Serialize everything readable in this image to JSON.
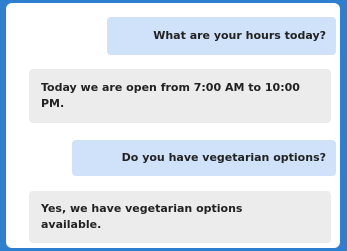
{
  "conversation": {
    "messages": [
      {
        "sender": "user",
        "text": "What are your hours today?"
      },
      {
        "sender": "bot",
        "text": "Today we are open from 7:00 AM to 10:00 PM."
      },
      {
        "sender": "user",
        "text": "Do you have vegetarian options?"
      },
      {
        "sender": "bot",
        "text": "Yes, we have vegetarian options available."
      }
    ]
  },
  "colors": {
    "background": "#2f7fd0",
    "user_bubble": "#cfe2f9",
    "bot_bubble": "#ececec"
  }
}
